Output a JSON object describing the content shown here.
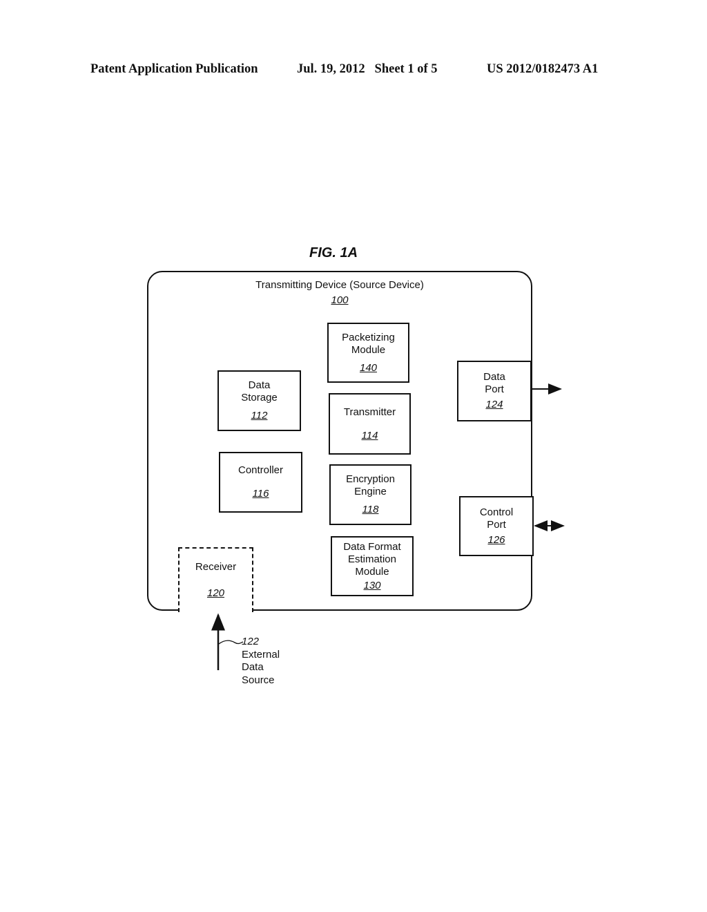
{
  "header": {
    "left": "Patent Application Publication",
    "middle": "Jul. 19, 2012   Sheet 1 of 5",
    "right": "US 2012/0182473 A1"
  },
  "figure": {
    "title": "FIG. 1A",
    "outer_box": {
      "label": "Transmitting Device (Source Device)",
      "ref": "100"
    },
    "modules": {
      "packetizing": {
        "label": "Packetizing\nModule",
        "ref": "140"
      },
      "data_storage": {
        "label": "Data\nStorage",
        "ref": "112"
      },
      "transmitter": {
        "label": "Transmitter",
        "ref": "114"
      },
      "controller": {
        "label": "Controller",
        "ref": "116"
      },
      "encryption": {
        "label": "Encryption\nEngine",
        "ref": "118"
      },
      "data_format": {
        "label": "Data Format\nEstimation\nModule",
        "ref": "130"
      },
      "receiver": {
        "label": "Receiver",
        "ref": "120"
      },
      "data_port": {
        "label": "Data\nPort",
        "ref": "124"
      },
      "control_port": {
        "label": "Control\nPort",
        "ref": "126"
      }
    },
    "external_source": {
      "ref": "122",
      "label": "External\nData\nSource"
    }
  }
}
